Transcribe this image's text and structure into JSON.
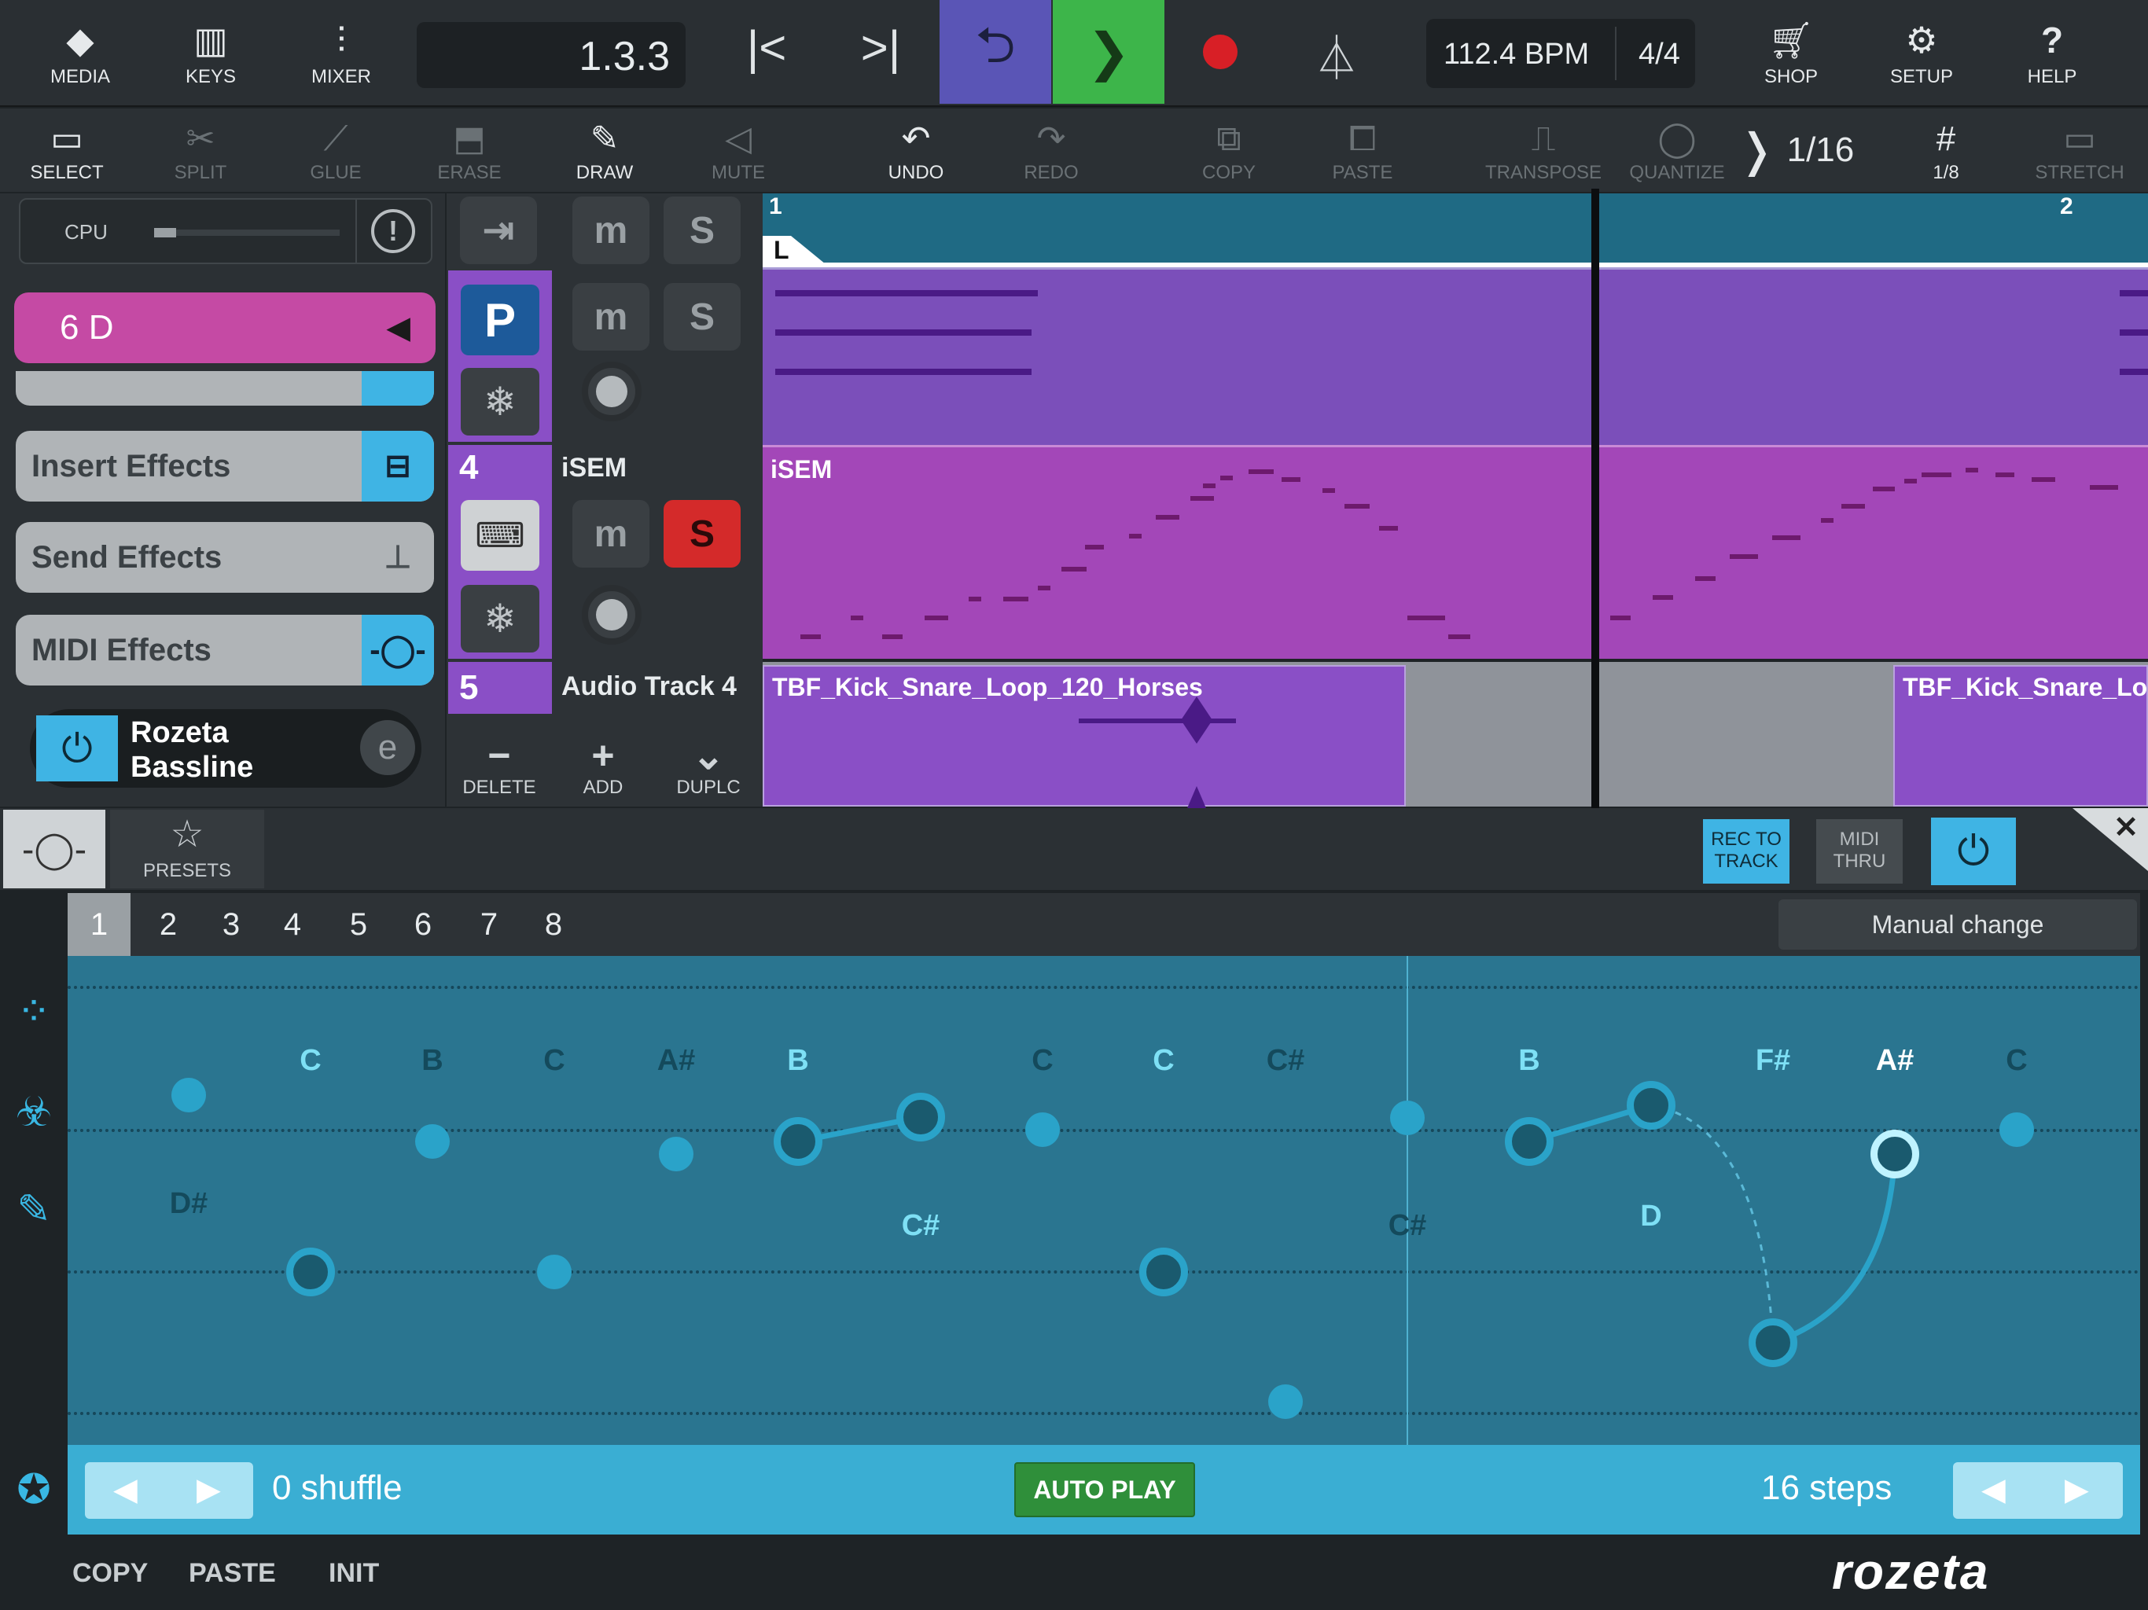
{
  "transport": {
    "media_label": "MEDIA",
    "keys_label": "KEYS",
    "mixer_label": "MIXER",
    "position": "1.3.3",
    "tempo": "112.4 BPM",
    "signature": "4/4",
    "shop_label": "SHOP",
    "setup_label": "SETUP",
    "help_label": "HELP",
    "colors": {
      "loop": "#5a55b6",
      "play": "#3db54a",
      "record": "#d81f26"
    }
  },
  "toolbar": {
    "select": "SELECT",
    "split": "SPLIT",
    "glue": "GLUE",
    "erase": "ERASE",
    "draw": "DRAW",
    "mute": "MUTE",
    "undo": "UNDO",
    "redo": "REDO",
    "copy": "COPY",
    "paste": "PASTE",
    "transpose": "TRANSPOSE",
    "quantize": "QUANTIZE",
    "quantize_value": "1/16",
    "grid_value": "1/8",
    "stretch": "STRETCH"
  },
  "left_panel": {
    "cpu_label": "CPU",
    "instrument_name": "6 D",
    "insert_effects": "Insert Effects",
    "send_effects": "Send Effects",
    "midi_effects": "MIDI Effects",
    "plugin_name": "Rozeta Bassline"
  },
  "tracks": {
    "track4_number": "4",
    "track4_name": "iSEM",
    "track5_number": "5",
    "track5_name": "Audio Track 4",
    "mute_glyph": "m",
    "solo_glyph": "S",
    "delete_label": "DELETE",
    "add_label": "ADD",
    "duplicate_label": "DUPLC"
  },
  "timeline": {
    "bar1": "1",
    "bar2": "2",
    "locator": "L",
    "region_isem": "iSEM",
    "region_audio1": "TBF_Kick_Snare_Loop_120_Horses",
    "region_audio2": "TBF_Kick_Snare_Lo",
    "colors": {
      "upper_region": "#7b4fba",
      "isem_region": "#a347b8",
      "audio_region": "#8a4fc6"
    }
  },
  "plugin": {
    "presets_label": "PRESETS",
    "rec_to_track": "REC TO TRACK",
    "midi_thru": "MIDI THRU",
    "manual_change": "Manual change",
    "patterns": [
      "1",
      "2",
      "3",
      "4",
      "5",
      "6",
      "7",
      "8"
    ],
    "selected_pattern": "1",
    "note_labels": [
      {
        "text": "C",
        "tone": "light"
      },
      {
        "text": "B",
        "tone": "dark"
      },
      {
        "text": "C",
        "tone": "dark"
      },
      {
        "text": "A#",
        "tone": "dark"
      },
      {
        "text": "B",
        "tone": "light"
      },
      {
        "text": "C",
        "tone": "dark"
      },
      {
        "text": "C",
        "tone": "light"
      },
      {
        "text": "C#",
        "tone": "dark"
      },
      {
        "text": "B",
        "tone": "light"
      },
      {
        "text": "F#",
        "tone": "light"
      },
      {
        "text": "A#",
        "tone": "white"
      },
      {
        "text": "C",
        "tone": "dark"
      }
    ],
    "lower_labels": [
      {
        "text": "D#",
        "tone": "dark"
      },
      {
        "text": "C#",
        "tone": "light"
      },
      {
        "text": "C#",
        "tone": "dark"
      },
      {
        "text": "D",
        "tone": "light"
      }
    ],
    "shuffle": "0 shuffle",
    "auto_play": "AUTO PLAY",
    "steps": "16 steps",
    "copy": "COPY",
    "paste": "PASTE",
    "init": "INIT",
    "brand": "rozeta"
  }
}
